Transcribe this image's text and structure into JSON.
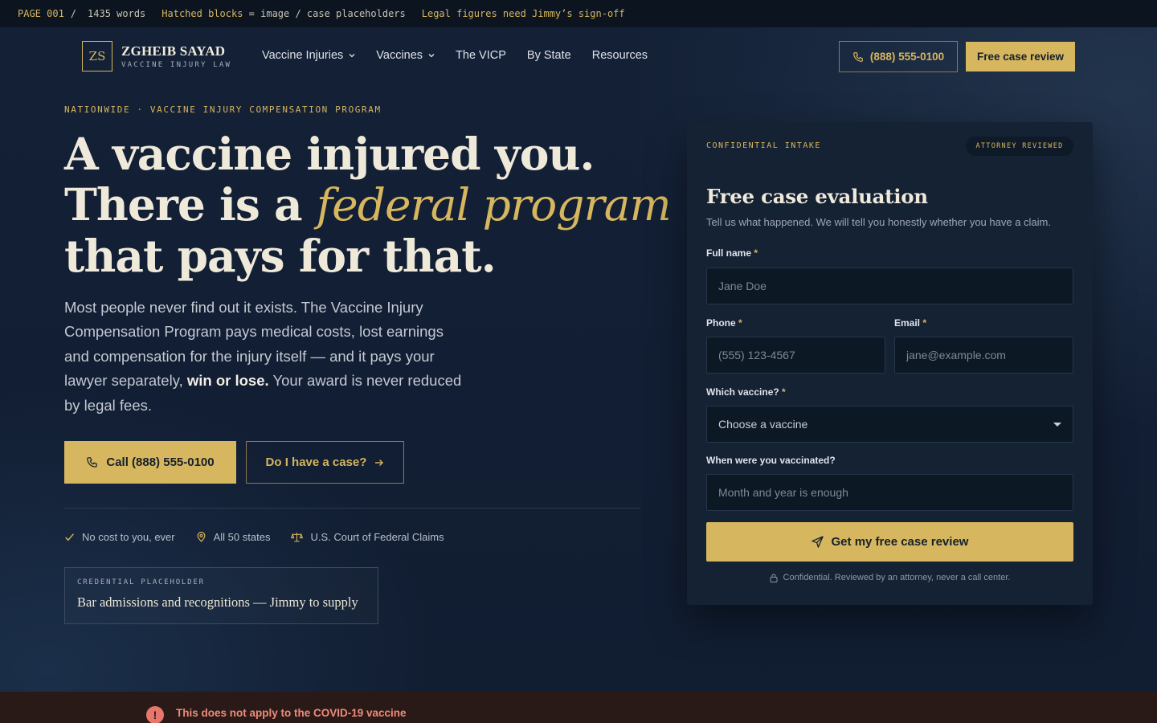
{
  "devbar": {
    "page": "PAGE 001",
    "slash": "/",
    "words": "1435 words",
    "hatched": "Hatched blocks",
    "hatched_rest": "= image / case placeholders",
    "legal": "Legal figures need Jimmy’s sign-off"
  },
  "brand": {
    "mark": "ZS",
    "name": "ZGHEIB SAYAD",
    "tagline": "VACCINE INJURY LAW"
  },
  "nav": {
    "items": [
      {
        "label": "Vaccine Injuries",
        "dropdown": true
      },
      {
        "label": "Vaccines",
        "dropdown": true
      },
      {
        "label": "The VICP",
        "dropdown": false
      },
      {
        "label": "By State",
        "dropdown": false
      },
      {
        "label": "Resources",
        "dropdown": false
      }
    ],
    "phone_label": "(888) 555-0100",
    "review_label": "Free case review"
  },
  "hero": {
    "eyebrow": "NATIONWIDE · VACCINE INJURY COMPENSATION PROGRAM",
    "headline_line1": "A vaccine injured you.",
    "headline_line2_pre": "There is a ",
    "headline_line2_em": "federal program",
    "headline_line3": "that pays for that.",
    "lede_pre": "Most people never find out it exists. The Vaccine Injury Compensation Program pays medical costs, lost earnings and compensation for the injury itself — and it pays your lawyer separately, ",
    "lede_bold": "win or lose.",
    "lede_post": " Your award is never reduced by legal fees.",
    "cta_call": "Call (888) 555-0100",
    "cta_case": "Do I have a case?",
    "trust": [
      {
        "icon": "check-icon",
        "label": "No cost to you, ever"
      },
      {
        "icon": "map-pin-icon",
        "label": "All 50 states"
      },
      {
        "icon": "scales-icon",
        "label": "U.S. Court of Federal Claims"
      }
    ],
    "credential_label": "CREDENTIAL PLACEHOLDER",
    "credential_text": "Bar admissions and recognitions — Jimmy to supply"
  },
  "form": {
    "eyebrow": "CONFIDENTIAL INTAKE",
    "badge": "ATTORNEY REVIEWED",
    "title": "Free case evaluation",
    "subtitle": "Tell us what happened. We will tell you honestly whether you have a claim.",
    "required_mark": "*",
    "name_label": "Full name",
    "name_placeholder": "Jane Doe",
    "phone_label": "Phone",
    "phone_placeholder": "(555) 123-4567",
    "email_label": "Email",
    "email_placeholder": "jane@example.com",
    "vaccine_label": "Which vaccine?",
    "vaccine_value": "Choose a vaccine",
    "date_label": "When were you vaccinated?",
    "date_placeholder": "Month and year is enough",
    "submit_label": "Get my free case review",
    "fineprint": "Confidential. Reviewed by an attorney, never a call center."
  },
  "alert": {
    "icon_glyph": "!",
    "text": "This does not apply to the COVID-19 vaccine"
  },
  "colors": {
    "gold": "#d6b65e",
    "navy": "#111d31",
    "alert_red": "#ef8a7c"
  }
}
